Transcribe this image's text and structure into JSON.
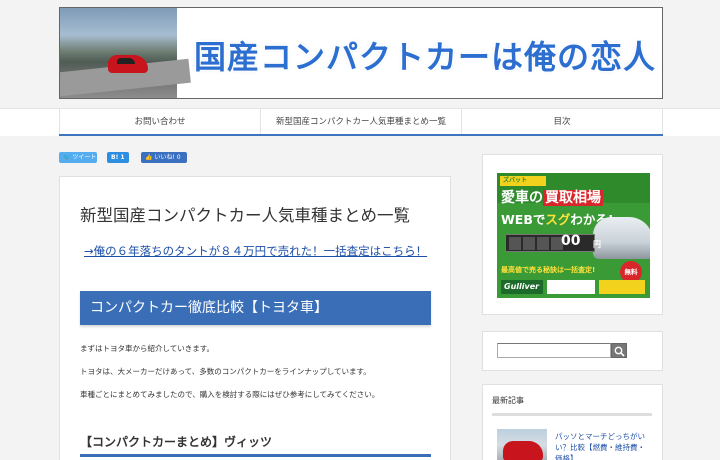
{
  "site": {
    "title": "国産コンパクトカーは俺の恋人"
  },
  "nav": {
    "items": [
      {
        "label": "お問い合わせ"
      },
      {
        "label": "新型国産コンパクトカー人気車種まとめ一覧"
      },
      {
        "label": "目次"
      }
    ]
  },
  "share": {
    "twitter": "ツイート",
    "hatena": "B!",
    "hatena_count": "1",
    "facebook": "いいね!",
    "facebook_count": "0"
  },
  "article": {
    "title": "新型国産コンパクトカー人気車種まとめ一覧",
    "promo_link": "→俺の６年落ちのタントが８４万円で売れた！一括査定はこちら！",
    "h2": "コンパクトカー徹底比較【トヨタ車】",
    "paragraphs": [
      "まずはトヨタ車から紹介していきます。",
      "トヨタは、大メーカーだけあって、多数のコンパクトカーをラインナップしています。",
      "車種ごとにまとめてみましたので、購入を検討する際にはぜひ参考にしてみてください。"
    ],
    "h3": "【コンパクトカーまとめ】ヴィッツ"
  },
  "sidebar": {
    "ad": {
      "badge": "ズバット",
      "headline_pre": "愛車の",
      "headline_hl": "買取相場",
      "subline_pre": "WEBで",
      "subline_hl": "スグ",
      "subline_post": "わかる!",
      "counter": "00",
      "yen": "円",
      "red_text": "最高値で売る秘訣は一括査定!",
      "free": "無料",
      "logo1": "Gulliver"
    },
    "search": {
      "placeholder": ""
    },
    "recent": {
      "heading": "最新記事",
      "posts": [
        {
          "title": "パッソとマーチどっちがいい？比較【燃費・維持費・価格】"
        }
      ]
    }
  }
}
